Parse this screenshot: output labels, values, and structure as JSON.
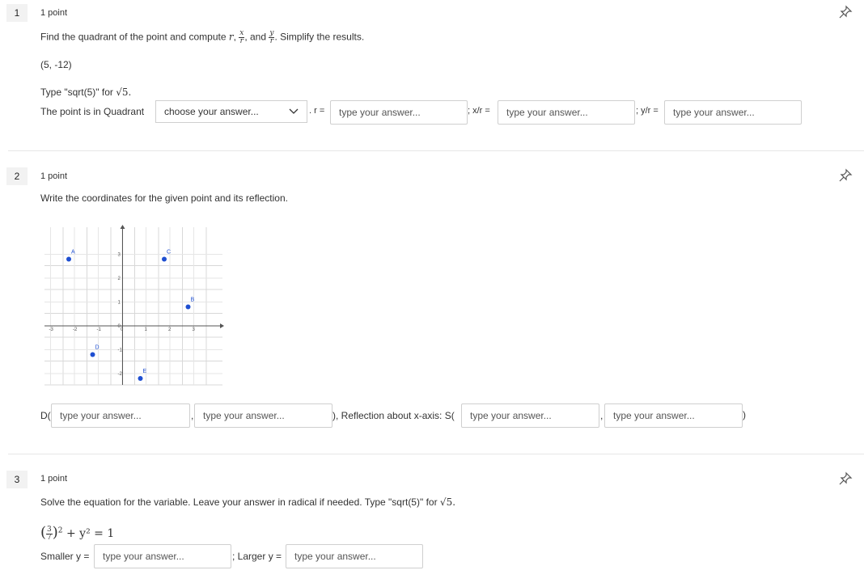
{
  "q1": {
    "number": "1",
    "points": "1 point",
    "prompt_before": "Find the quadrant of the point and compute ",
    "r_var": "r",
    "frac1_num": "x",
    "frac1_den": "r",
    "and_text": ", and ",
    "frac2_num": "y",
    "frac2_den": "r",
    "prompt_after": ". Simplify the results.",
    "point": "(5, -12)",
    "hint": "Type \"sqrt(5)\" for ",
    "hint_math": "√5.",
    "quadrant_label": "The point is in Quadrant",
    "select_value": "choose your answer...",
    "r_label": ". r =",
    "xr_label": "; x/r =",
    "yr_label": "; y/r =",
    "placeholder": "type your answer..."
  },
  "q2": {
    "number": "2",
    "points": "1 point",
    "prompt": "Write the coordinates for the given point and its reflection.",
    "d_label": "D(",
    "comma": ",",
    "reflect_label": "), Reflection about x-axis: S(",
    "close": ")",
    "placeholder": "type your answer...",
    "graph": {
      "x_ticks": [
        "-3",
        "-2",
        "-1",
        "0",
        "1",
        "2",
        "3"
      ],
      "y_ticks": [
        "3",
        "2",
        "1",
        "0",
        "-1",
        "-2"
      ],
      "points": [
        {
          "label": "A",
          "x": -2,
          "y": 3
        },
        {
          "label": "C",
          "x": 2,
          "y": 3
        },
        {
          "label": "B",
          "x": 3,
          "y": 1
        },
        {
          "label": "D",
          "x": -1,
          "y": -1
        },
        {
          "label": "E",
          "x": 1,
          "y": -2
        }
      ]
    }
  },
  "q3": {
    "number": "3",
    "points": "1 point",
    "prompt": "Solve the equation for the variable. Leave your answer in radical if needed. Type \"sqrt(5)\" for ",
    "prompt_math": "√5.",
    "eq_num": "3",
    "eq_den": "7",
    "eq_rest": " + y² = 1",
    "smaller_label": "Smaller y =",
    "larger_label": "; Larger y =",
    "placeholder": "type your answer..."
  }
}
